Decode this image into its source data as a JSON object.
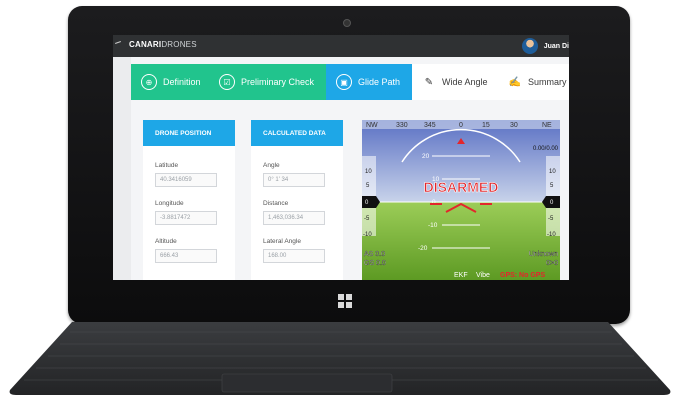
{
  "app": {
    "brand_bold": "CANARI",
    "brand_light": "DRONES",
    "user_name": "Juan Di"
  },
  "tabs": [
    {
      "label": "Definition",
      "icon": "crosshair-icon",
      "state": "complete"
    },
    {
      "label": "Preliminary Check",
      "icon": "checkbox-icon",
      "state": "complete"
    },
    {
      "label": "Glide Path",
      "icon": "image-icon",
      "state": "active"
    },
    {
      "label": "Wide Angle",
      "icon": "pencil-icon",
      "state": "pending"
    },
    {
      "label": "Summary",
      "icon": "edit-icon",
      "state": "pending"
    }
  ],
  "drone_position": {
    "title": "DRONE POSITION",
    "latitude_label": "Latitude",
    "latitude_value": "40.3416059",
    "longitude_label": "Longitude",
    "longitude_value": "-3.8817472",
    "altitude_label": "Altitude",
    "altitude_value": "666.43"
  },
  "calculated_data": {
    "title": "CALCULATED DATA",
    "angle_label": "Angle",
    "angle_value": "0° 1' 34",
    "distance_label": "Distance",
    "distance_value": "1,463,036.34",
    "lateral_label": "Lateral Angle",
    "lateral_value": "168.00"
  },
  "hud": {
    "status": "DISARMED",
    "heading_labels": [
      "NW",
      "330",
      "345",
      "0",
      "15",
      "30",
      "NE"
    ],
    "pitch_labels": [
      "20",
      "10",
      "0",
      "-10",
      "-20"
    ],
    "speed_labels": [
      "10",
      "5",
      "0",
      "-5",
      "-10"
    ],
    "alt_labels": [
      "10",
      "5",
      "0",
      "-5",
      "-10"
    ],
    "left_readout_1": "AS 0.0",
    "left_readout_2": "GS 0.0",
    "right_readout_1": "Unknown",
    "right_readout_2": "0>0",
    "right_top": "0.00/0.00",
    "bottom_ekf": "EKF",
    "bottom_vibe": "Vibe",
    "bottom_gps": "GPS: No GPS",
    "colors": {
      "sky": "#6f84c9",
      "ground": "#7fbf3a",
      "status": "#e3262b"
    }
  }
}
